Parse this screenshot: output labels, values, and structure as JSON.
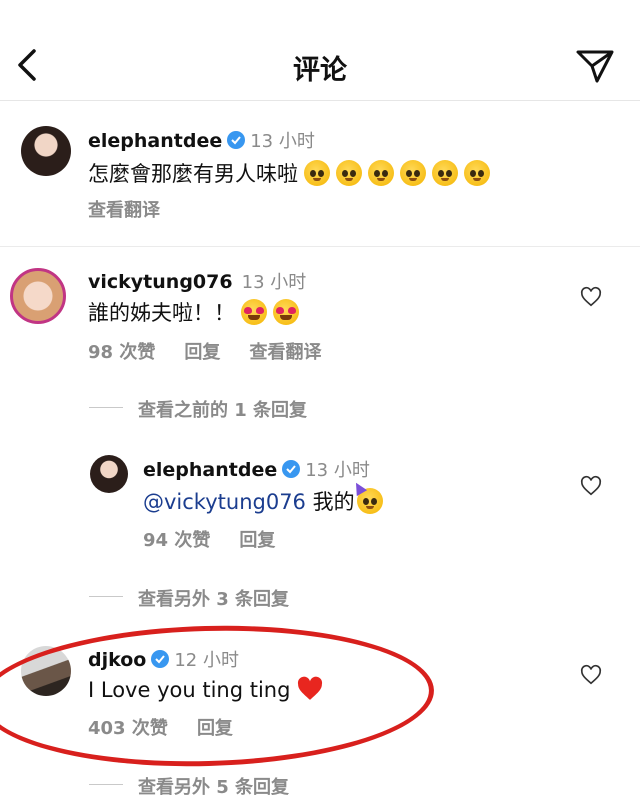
{
  "header": {
    "title": "评论"
  },
  "comments": [
    {
      "username": "elephantdee",
      "verified": true,
      "time": "13 小时",
      "text": "怎麼會那麼有男人味啦",
      "emojis": [
        "pleading-face-emoji",
        "pleading-face-emoji",
        "pleading-face-emoji",
        "pleading-face-emoji",
        "pleading-face-emoji",
        "pleading-face-emoji"
      ],
      "translate": "查看翻译"
    },
    {
      "username": "vickytung076",
      "verified": false,
      "time": "13 小时",
      "text": "誰的姊夫啦！！",
      "emojis": [
        "heart-eyes-emoji",
        "heart-eyes-emoji"
      ],
      "likes": "98 次赞",
      "reply": "回复",
      "translate": "查看翻译",
      "view_previous": "查看之前的 1 条回复",
      "replies": [
        {
          "username": "elephantdee",
          "verified": true,
          "time": "13 小时",
          "mention": "@vickytung076",
          "text": "我的",
          "emojis": [
            "partying-face-emoji"
          ],
          "likes": "94 次赞",
          "reply": "回复"
        }
      ],
      "view_more": "查看另外 3 条回复"
    },
    {
      "username": "djkoo",
      "verified": true,
      "time": "12 小时",
      "text": "I Love you ting ting",
      "emojis": [
        "red-heart-emoji"
      ],
      "likes": "403 次赞",
      "reply": "回复",
      "view_more": "查看另外 5 条回复"
    }
  ],
  "colors": {
    "verified": "#3897f0",
    "annotation": "#d8201d",
    "mention": "#1b3d8f",
    "secondary": "#8a8a8a"
  }
}
